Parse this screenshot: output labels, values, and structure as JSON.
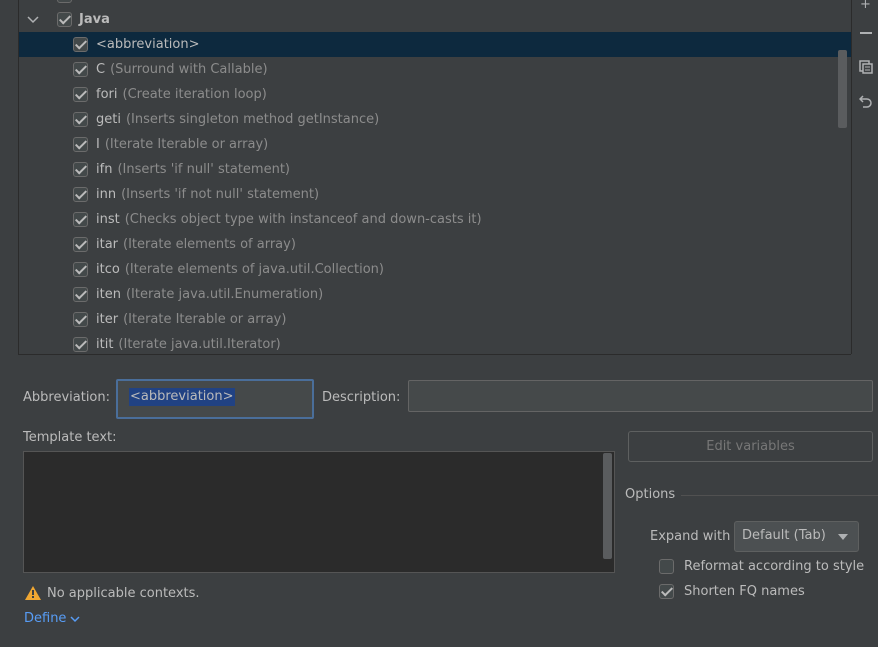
{
  "tree": {
    "group": {
      "label": "Java",
      "checked": true,
      "expanded": true
    },
    "items": [
      {
        "abbr": "<abbreviation>",
        "desc": "",
        "checked": true,
        "selected": true
      },
      {
        "abbr": "C",
        "desc": "(Surround with Callable)",
        "checked": true
      },
      {
        "abbr": "fori",
        "desc": "(Create iteration loop)",
        "checked": true
      },
      {
        "abbr": "geti",
        "desc": "(Inserts singleton method getInstance)",
        "checked": true
      },
      {
        "abbr": "I",
        "desc": "(Iterate Iterable or array)",
        "checked": true
      },
      {
        "abbr": "ifn",
        "desc": "(Inserts 'if null' statement)",
        "checked": true
      },
      {
        "abbr": "inn",
        "desc": "(Inserts 'if not null' statement)",
        "checked": true
      },
      {
        "abbr": "inst",
        "desc": "(Checks object type with instanceof and down-casts it)",
        "checked": true
      },
      {
        "abbr": "itar",
        "desc": "(Iterate elements of array)",
        "checked": true
      },
      {
        "abbr": "itco",
        "desc": "(Iterate elements of java.util.Collection)",
        "checked": true
      },
      {
        "abbr": "iten",
        "desc": "(Iterate java.util.Enumeration)",
        "checked": true
      },
      {
        "abbr": "iter",
        "desc": "(Iterate Iterable or array)",
        "checked": true
      },
      {
        "abbr": "itit",
        "desc": "(Iterate java.util.Iterator)",
        "checked": true
      }
    ]
  },
  "toolbar": {
    "icons": [
      "add-icon",
      "remove-icon",
      "copy-icon",
      "restore-icon"
    ],
    "add_glyph": "+",
    "remove_glyph": "−",
    "copy_glyph": "⧉",
    "restore_glyph": "↶"
  },
  "form": {
    "abbreviation_label": "Abbreviation:",
    "abbreviation_value": "<abbreviation>",
    "description_label": "Description:",
    "description_value": "",
    "template_text_label": "Template text:",
    "template_text_value": "",
    "edit_variables_label": "Edit variables"
  },
  "options": {
    "title": "Options",
    "expand_with_label": "Expand with",
    "expand_with_value": "Default (Tab)",
    "reformat_label": "Reformat according to style",
    "reformat_checked": false,
    "shorten_label": "Shorten FQ names",
    "shorten_checked": true
  },
  "contexts": {
    "warning_text": "No applicable contexts.",
    "define_label": "Define"
  },
  "colors": {
    "background": "#3c3f41",
    "selection": "#0d293e",
    "accent_border": "#4a6e9a",
    "link": "#589df6",
    "warning": "#f0a732"
  }
}
